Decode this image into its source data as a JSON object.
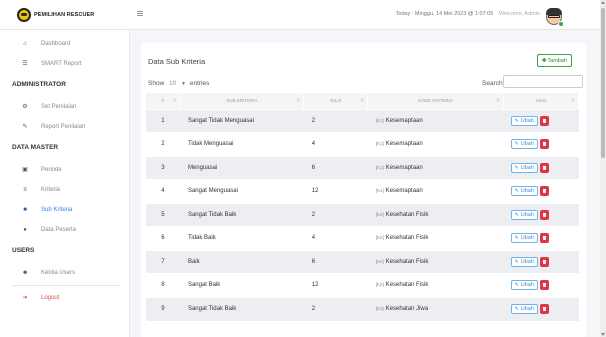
{
  "brand": {
    "name": "PEMILIHAN RESCUER"
  },
  "topbar": {
    "datetime": "Today : Minggu, 14 Mei 2023 @ 1:07:05",
    "welcome": "Welcome, Admin"
  },
  "sidebar": {
    "dashboard": "Dashboard",
    "smart_report": "SMART Report",
    "admin_head": "ADMINISTRATOR",
    "set_penilaian": "Set Penilaian",
    "report_penilaian": "Report Penilaian",
    "master_head": "DATA MASTER",
    "periode": "Periode",
    "kriteria": "Kriteria",
    "sub_kriteria": "Sub Kriteria",
    "data_peserta": "Data Peserta",
    "users_head": "USERS",
    "kelola_users": "Kelola Users",
    "logout": "Logout"
  },
  "main": {
    "title": "Data Sub Kriteria",
    "add_label": "Tambah",
    "show_label": "Show",
    "show_value": "10",
    "entries_label": "entries",
    "search_label": "Search:",
    "search_value": ""
  },
  "table": {
    "headers": [
      "#",
      "SUB KRITERIA",
      "NILAI",
      "KODE KRITERIA",
      "AKSI"
    ],
    "edit_label": "Ubah",
    "rows": [
      {
        "no": "1",
        "sub": "Sangat Tidak Menguasai",
        "nilai": "2",
        "code": "[K1]",
        "kriteria": "Kesemaptaan"
      },
      {
        "no": "2",
        "sub": "Tidak Menguasai",
        "nilai": "4",
        "code": "[K1]",
        "kriteria": "Kesemaptaan"
      },
      {
        "no": "3",
        "sub": "Menguasai",
        "nilai": "6",
        "code": "[K1]",
        "kriteria": "Kesemaptaan"
      },
      {
        "no": "4",
        "sub": "Sangat Menguasai",
        "nilai": "12",
        "code": "[K1]",
        "kriteria": "Kesemaptaan"
      },
      {
        "no": "5",
        "sub": "Sangat Tidak Baik",
        "nilai": "2",
        "code": "[K2]",
        "kriteria": "Kesehatan Fisik"
      },
      {
        "no": "6",
        "sub": "Tidak Baik",
        "nilai": "4",
        "code": "[K2]",
        "kriteria": "Kesehatan Fisik"
      },
      {
        "no": "7",
        "sub": "Baik",
        "nilai": "6",
        "code": "[K2]",
        "kriteria": "Kesehatan Fisik"
      },
      {
        "no": "8",
        "sub": "Sangat Baik",
        "nilai": "12",
        "code": "[K2]",
        "kriteria": "Kesehatan Fisik"
      },
      {
        "no": "9",
        "sub": "Sangat Tidak Baik",
        "nilai": "2",
        "code": "[K3]",
        "kriteria": "Kesehatan Jiwa"
      }
    ]
  }
}
